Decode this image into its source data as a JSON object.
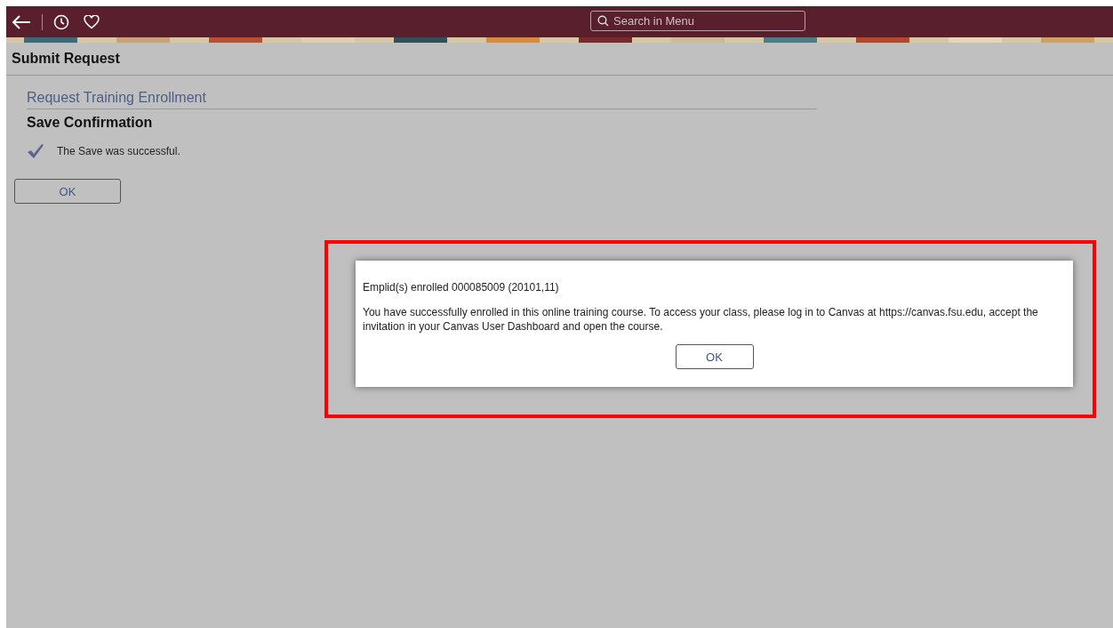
{
  "header": {
    "search": {
      "placeholder": "Search in Menu"
    }
  },
  "page_title": "Submit Request",
  "section_title": "Request Training Enrollment",
  "subheading": "Save Confirmation",
  "message": "The Save was successful.",
  "ok_button": "OK",
  "dialog": {
    "lines": [
      "Emplid(s) enrolled 000085009 (20101,11)",
      "You have successfully enrolled in this online training course. To access your class, please log in to Canvas at https://canvas.fsu.edu, accept the invitation in your Canvas User Dashboard and open the course."
    ],
    "button": "OK",
    "highlighted": true
  }
}
